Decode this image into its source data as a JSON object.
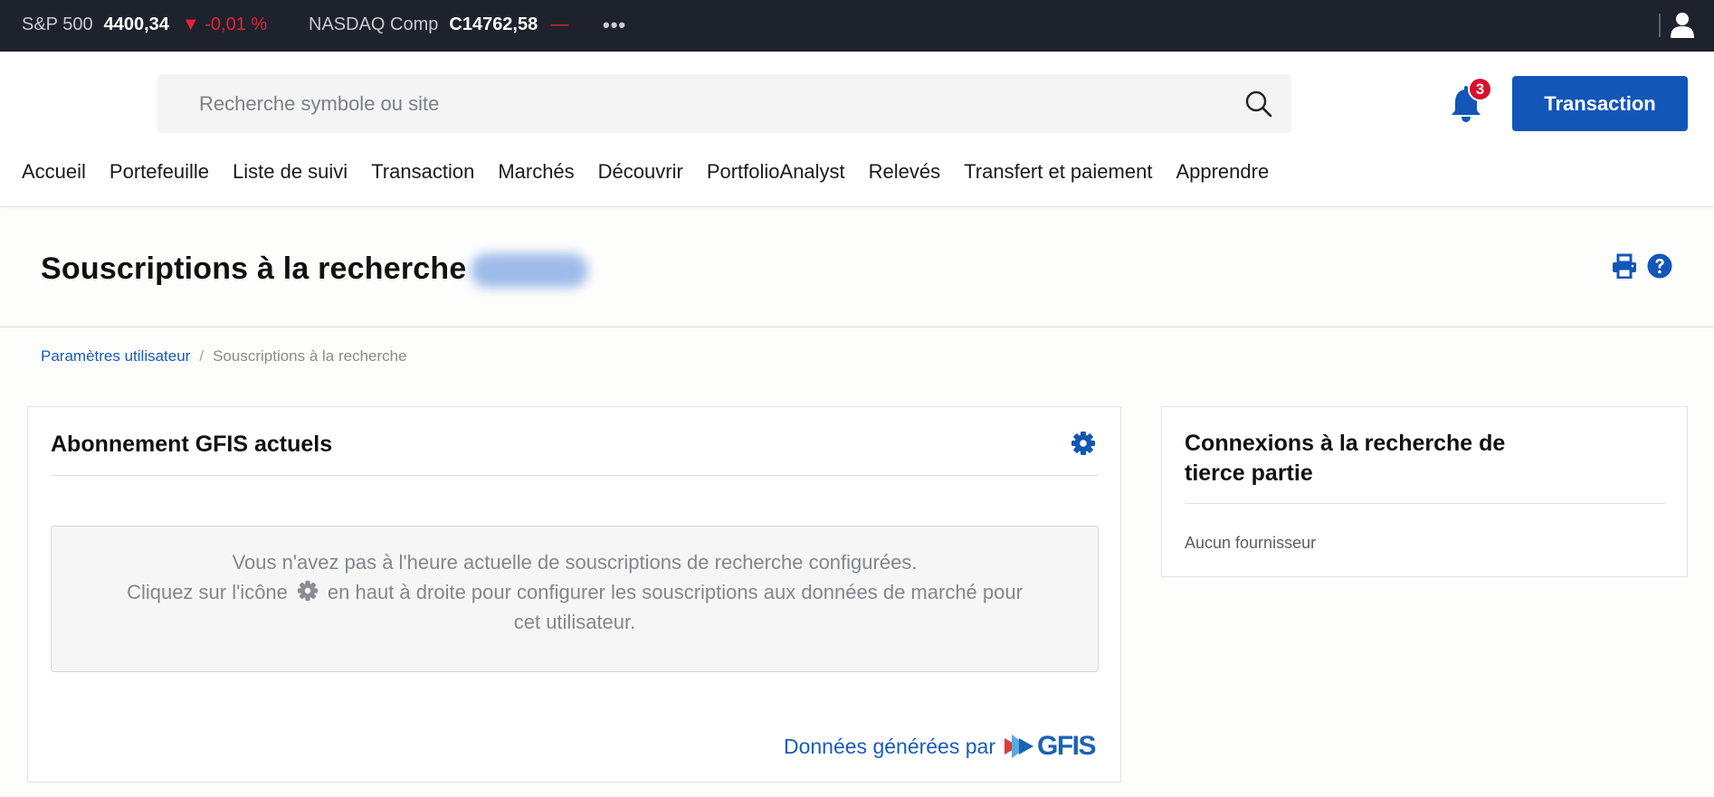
{
  "ticker": {
    "items": [
      {
        "name": "S&P 500",
        "value": "4400,34",
        "change": "▼ -0,01 %",
        "direction": "down"
      },
      {
        "name": "NASDAQ Comp",
        "value": "C14762,58",
        "change": "—",
        "direction": "flat"
      }
    ],
    "more": "•••"
  },
  "search": {
    "placeholder": "Recherche symbole ou site"
  },
  "notifications": {
    "count": "3"
  },
  "trade_button": "Transaction",
  "nav": [
    "Accueil",
    "Portefeuille",
    "Liste de suivi",
    "Transaction",
    "Marchés",
    "Découvrir",
    "PortfolioAnalyst",
    "Relevés",
    "Transfert et paiement",
    "Apprendre"
  ],
  "page": {
    "title": "Souscriptions à la recherche"
  },
  "breadcrumb": {
    "parent": "Paramètres utilisateur",
    "separator": "/",
    "current": "Souscriptions à la recherche"
  },
  "gfis_card": {
    "title": "Abonnement GFIS actuels",
    "empty_line1": "Vous n'avez pas à l'heure actuelle de souscriptions de recherche configurées.",
    "empty_line2_before": "Cliquez sur l'icône",
    "empty_line2_after": "en haut à droite pour configurer les souscriptions aux données de marché pour",
    "empty_line3": "cet utilisateur.",
    "powered_by": "Données générées par",
    "logo_text": "GFIS"
  },
  "third_party_card": {
    "title": "Connexions à la recherche de tierce partie",
    "text": "Aucun fournisseur"
  },
  "colors": {
    "accent": "#1256b8",
    "ticker_bg": "#1e222c",
    "down": "#e5203a",
    "badge": "#d9122c"
  },
  "icons": [
    "user-icon",
    "search-icon",
    "bell-icon",
    "print-icon",
    "help-icon",
    "gear-icon",
    "gfis-logo"
  ]
}
